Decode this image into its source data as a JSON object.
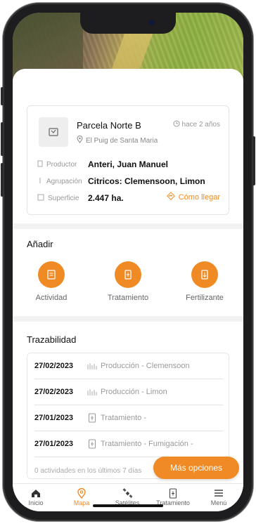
{
  "parcel": {
    "name": "Parcela Norte B",
    "location": "El Puig de Santa Maria",
    "time_ago": "hace 2 años",
    "producer_label": "Productor",
    "producer_value": "Anteri, Juan Manuel",
    "group_label": "Agrupación",
    "group_value": "Citricos: Clemensoon, Limon",
    "surface_label": "Superficie",
    "surface_value": "2.447 ha.",
    "directions_label": "Cómo llegar"
  },
  "add": {
    "title": "Añadir",
    "items": [
      {
        "label": "Actividad",
        "icon": "activity-icon"
      },
      {
        "label": "Tratamiento",
        "icon": "treatment-icon"
      },
      {
        "label": "Fertilizante",
        "icon": "fertilizer-icon"
      }
    ]
  },
  "traceability": {
    "title": "Trazabilidad",
    "rows": [
      {
        "date": "27/02/2023",
        "icon": "production-icon",
        "text": "Producción  - Clemensoon"
      },
      {
        "date": "27/02/2023",
        "icon": "production-icon",
        "text": "Producción  - Limon"
      },
      {
        "date": "27/01/2023",
        "icon": "treatment-icon",
        "text": "Tratamiento -"
      },
      {
        "date": "27/01/2023",
        "icon": "treatment-icon",
        "text": "Tratamiento - Fumigación -"
      }
    ],
    "footer": "0 actividades en los últimos 7 días"
  },
  "more_options": "Más opciones",
  "tabbar": {
    "items": [
      {
        "label": "Inicio",
        "icon": "home-icon",
        "active": false
      },
      {
        "label": "Mapa",
        "icon": "map-pin-icon",
        "active": true
      },
      {
        "label": "Satélites",
        "icon": "satellite-icon",
        "active": false
      },
      {
        "label": "Tratamiento",
        "icon": "treatment-icon",
        "active": false
      },
      {
        "label": "Menú",
        "icon": "menu-icon",
        "active": false
      }
    ]
  },
  "colors": {
    "accent": "#f08a24",
    "text": "#111111",
    "muted": "#9a9a9a"
  }
}
